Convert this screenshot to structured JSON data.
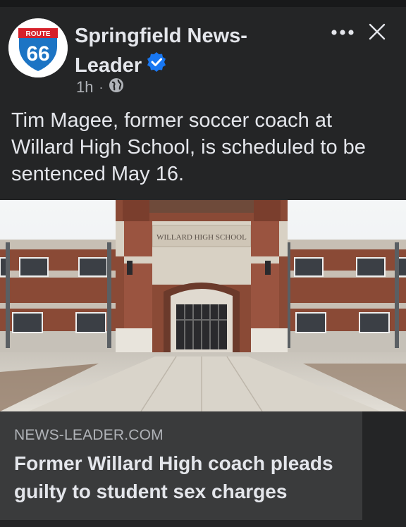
{
  "post": {
    "page_name": "Springfield News-Leader",
    "timestamp": "1h",
    "separator": "·",
    "audience_icon": "globe-icon",
    "verified_icon": "verified-badge-icon",
    "avatar": {
      "sign_top": "ROUTE",
      "sign_number": "66"
    },
    "text": "Tim Magee, former soccer coach at Willard High School, is scheduled to be sentenced May 16."
  },
  "photo": {
    "sign_text": "WILLARD HIGH SCHOOL"
  },
  "link_card": {
    "domain": "NEWS-LEADER.COM",
    "title": "Former Willard High coach pleads guilty to student sex charges"
  },
  "icons": {
    "more": "more-options-icon",
    "close": "close-icon"
  },
  "colors": {
    "background": "#242526",
    "card": "#3a3b3c",
    "text_primary": "#e4e6eb",
    "text_secondary": "#b0b3b8",
    "verified": "#1877f2"
  }
}
